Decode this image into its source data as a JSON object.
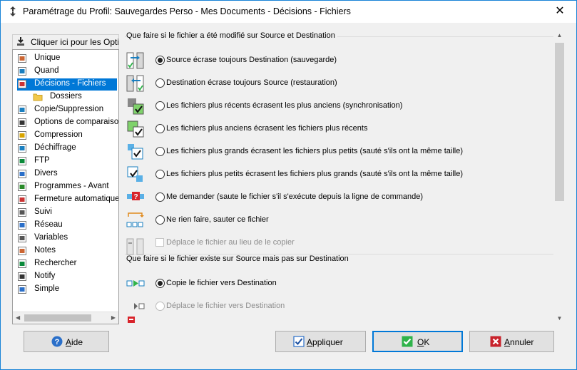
{
  "window": {
    "title": "Paramétrage du Profil: Sauvegardes Perso - Mes Documents - Décisions - Fichiers",
    "close_label": "✕"
  },
  "sidebar": {
    "click_here_label": "Cliquer ici pour les Opti",
    "items": [
      {
        "label": "Unique",
        "icon": "unique-icon"
      },
      {
        "label": "Quand",
        "icon": "clock-icon"
      },
      {
        "label": "Décisions - Fichiers",
        "icon": "decisions-icon",
        "selected": true
      },
      {
        "label": "Dossiers",
        "icon": "folder-icon"
      },
      {
        "label": "Copie/Suppression",
        "icon": "copy-icon"
      },
      {
        "label": "Options de comparaiso",
        "icon": "compare-icon"
      },
      {
        "label": "Compression",
        "icon": "compression-icon"
      },
      {
        "label": "Déchiffrage",
        "icon": "decrypt-icon"
      },
      {
        "label": "FTP",
        "icon": "ftp-icon"
      },
      {
        "label": "Divers",
        "icon": "misc-icon"
      },
      {
        "label": "Programmes - Avant",
        "icon": "programs-icon"
      },
      {
        "label": "Fermeture automatique",
        "icon": "autoclose-icon"
      },
      {
        "label": "Suivi",
        "icon": "tracking-icon"
      },
      {
        "label": "Réseau",
        "icon": "network-icon"
      },
      {
        "label": "Variables",
        "icon": "variables-icon"
      },
      {
        "label": "Notes",
        "icon": "notes-icon"
      },
      {
        "label": "Rechercher",
        "icon": "search-icon"
      },
      {
        "label": "Notify",
        "icon": "notify-icon"
      },
      {
        "label": "Simple",
        "icon": "simple-icon"
      }
    ]
  },
  "group1": {
    "title": "Que faire si le fichier a été modifié sur Source et Destination",
    "options": [
      {
        "label": "Source écrase toujours Destination (sauvegarde)",
        "checked": true,
        "icon": "source-overwrite-icon"
      },
      {
        "label": "Destination écrase toujours Source (restauration)",
        "checked": false,
        "icon": "destination-overwrite-icon"
      },
      {
        "label": "Les fichiers plus récents écrasent les plus anciens (synchronisation)",
        "checked": false,
        "icon": "newer-overwrite-icon"
      },
      {
        "label": "Les fichiers plus anciens écrasent les fichiers plus récents",
        "checked": false,
        "icon": "older-overwrite-icon"
      },
      {
        "label": "Les fichiers plus grands écrasent les fichiers plus petits (sauté s'ils ont la même taille)",
        "checked": false,
        "icon": "larger-overwrite-icon"
      },
      {
        "label": "Les fichiers plus petits écrasent les fichiers plus grands (sauté s'ils ont la même taille)",
        "checked": false,
        "icon": "smaller-overwrite-icon"
      },
      {
        "label": "Me demander (saute le fichier s'il s'exécute depuis la ligne de commande)",
        "checked": false,
        "icon": "ask-icon"
      },
      {
        "label": "Ne rien faire, sauter ce fichier",
        "checked": false,
        "icon": "skip-icon"
      }
    ],
    "move_checkbox_label": "Déplace le fichier au lieu de le copier"
  },
  "group2": {
    "title": "Que faire si le fichier existe sur Source mais pas sur Destination",
    "options": [
      {
        "label": "Copie le fichier vers Destination",
        "checked": true,
        "disabled": false,
        "icon": "copy-to-destination-icon"
      },
      {
        "label": "Déplace le fichier vers Destination",
        "checked": false,
        "disabled": true,
        "icon": "move-to-destination-icon"
      }
    ]
  },
  "buttons": {
    "help_label": "Aide",
    "apply_label": "Appliquer",
    "ok_label": "OK",
    "cancel_label": "Annuler"
  },
  "colors": {
    "selection": "#0078d7",
    "window_border": "#1883d7",
    "check_green": "#2fb34a",
    "cancel_red": "#c8232c"
  }
}
